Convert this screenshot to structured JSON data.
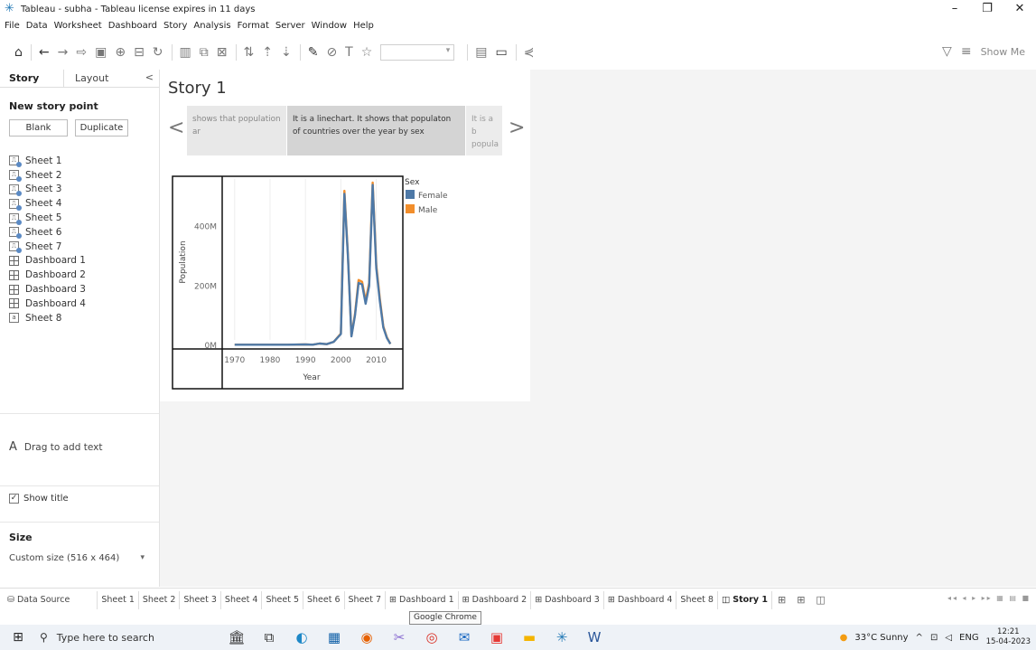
{
  "window": {
    "title": "Tableau - subha - Tableau license expires in 11 days",
    "controls": [
      "–",
      "❐",
      "✕"
    ]
  },
  "menu": [
    "File",
    "Data",
    "Worksheet",
    "Dashboard",
    "Story",
    "Analysis",
    "Format",
    "Server",
    "Window",
    "Help"
  ],
  "toolbar": {
    "show_me": "Show Me"
  },
  "left_pane": {
    "tabs": [
      "Story",
      "Layout"
    ],
    "new_story_point": "New story point",
    "blank_label": "Blank",
    "duplicate_label": "Duplicate",
    "sheets": [
      {
        "label": "Sheet 1",
        "kind": "sheet"
      },
      {
        "label": "Sheet 2",
        "kind": "sheet"
      },
      {
        "label": "Sheet 3",
        "kind": "sheet"
      },
      {
        "label": "Sheet 4",
        "kind": "sheet"
      },
      {
        "label": "Sheet 5",
        "kind": "sheet"
      },
      {
        "label": "Sheet 6",
        "kind": "sheet"
      },
      {
        "label": "Sheet 7",
        "kind": "sheet"
      },
      {
        "label": "Dashboard 1",
        "kind": "dashboard"
      },
      {
        "label": "Dashboard 2",
        "kind": "dashboard"
      },
      {
        "label": "Dashboard 3",
        "kind": "dashboard"
      },
      {
        "label": "Dashboard 4",
        "kind": "dashboard"
      },
      {
        "label": "Sheet 8",
        "kind": "plain"
      }
    ],
    "drag_text": "Drag to add text",
    "show_title": "Show title",
    "size_heading": "Size",
    "size_value": "Custom size (516 x 464)"
  },
  "story": {
    "title": "Story 1",
    "points": {
      "left": "shows that population ar",
      "mid": "It is a linechart. It shows that populaton of countries over the year by sex",
      "right": "It is a b popula"
    }
  },
  "chart_data": {
    "type": "line",
    "xlabel": "Year",
    "ylabel": "Population",
    "x_ticks": [
      "1970",
      "1980",
      "1990",
      "2000",
      "2010"
    ],
    "y_ticks": [
      "0M",
      "200M",
      "400M"
    ],
    "xlim": [
      1967,
      2017
    ],
    "ylim": [
      0,
      560
    ],
    "legend_title": "Sex",
    "x": [
      1970,
      1975,
      1980,
      1985,
      1990,
      1992,
      1994,
      1996,
      1998,
      2000,
      2001,
      2002,
      2003,
      2004,
      2005,
      2006,
      2007,
      2008,
      2009,
      2010,
      2011,
      2012,
      2013,
      2014
    ],
    "series": [
      {
        "name": "Female",
        "color": "#4e79a7",
        "values": [
          2,
          2,
          2,
          2,
          3,
          2,
          6,
          4,
          12,
          38,
          510,
          300,
          30,
          100,
          210,
          205,
          140,
          200,
          540,
          260,
          150,
          60,
          25,
          5
        ]
      },
      {
        "name": "Male",
        "color": "#f28e2b",
        "values": [
          2,
          2,
          2,
          2,
          3,
          2,
          6,
          4,
          12,
          40,
          520,
          305,
          32,
          105,
          220,
          214,
          150,
          210,
          548,
          270,
          158,
          64,
          27,
          5
        ]
      }
    ],
    "legend_placement": "right"
  },
  "sheet_tabs": [
    {
      "label": "Data Source",
      "kind": "ds"
    },
    {
      "label": "Sheet 1"
    },
    {
      "label": "Sheet 2"
    },
    {
      "label": "Sheet 3"
    },
    {
      "label": "Sheet 4"
    },
    {
      "label": "Sheet 5"
    },
    {
      "label": "Sheet 6"
    },
    {
      "label": "Sheet 7"
    },
    {
      "label": "Dashboard 1",
      "kind": "dash"
    },
    {
      "label": "Dashboard 2",
      "kind": "dash"
    },
    {
      "label": "Dashboard 3",
      "kind": "dash"
    },
    {
      "label": "Dashboard 4",
      "kind": "dash"
    },
    {
      "label": "Sheet 8"
    },
    {
      "label": "Story 1",
      "kind": "story",
      "active": true
    }
  ],
  "tooltip": "Google Chrome",
  "taskbar": {
    "search_placeholder": "Type here to search",
    "weather": "33°C  Sunny",
    "lang": "ENG",
    "time": "12:21",
    "date": "15-04-2023"
  }
}
